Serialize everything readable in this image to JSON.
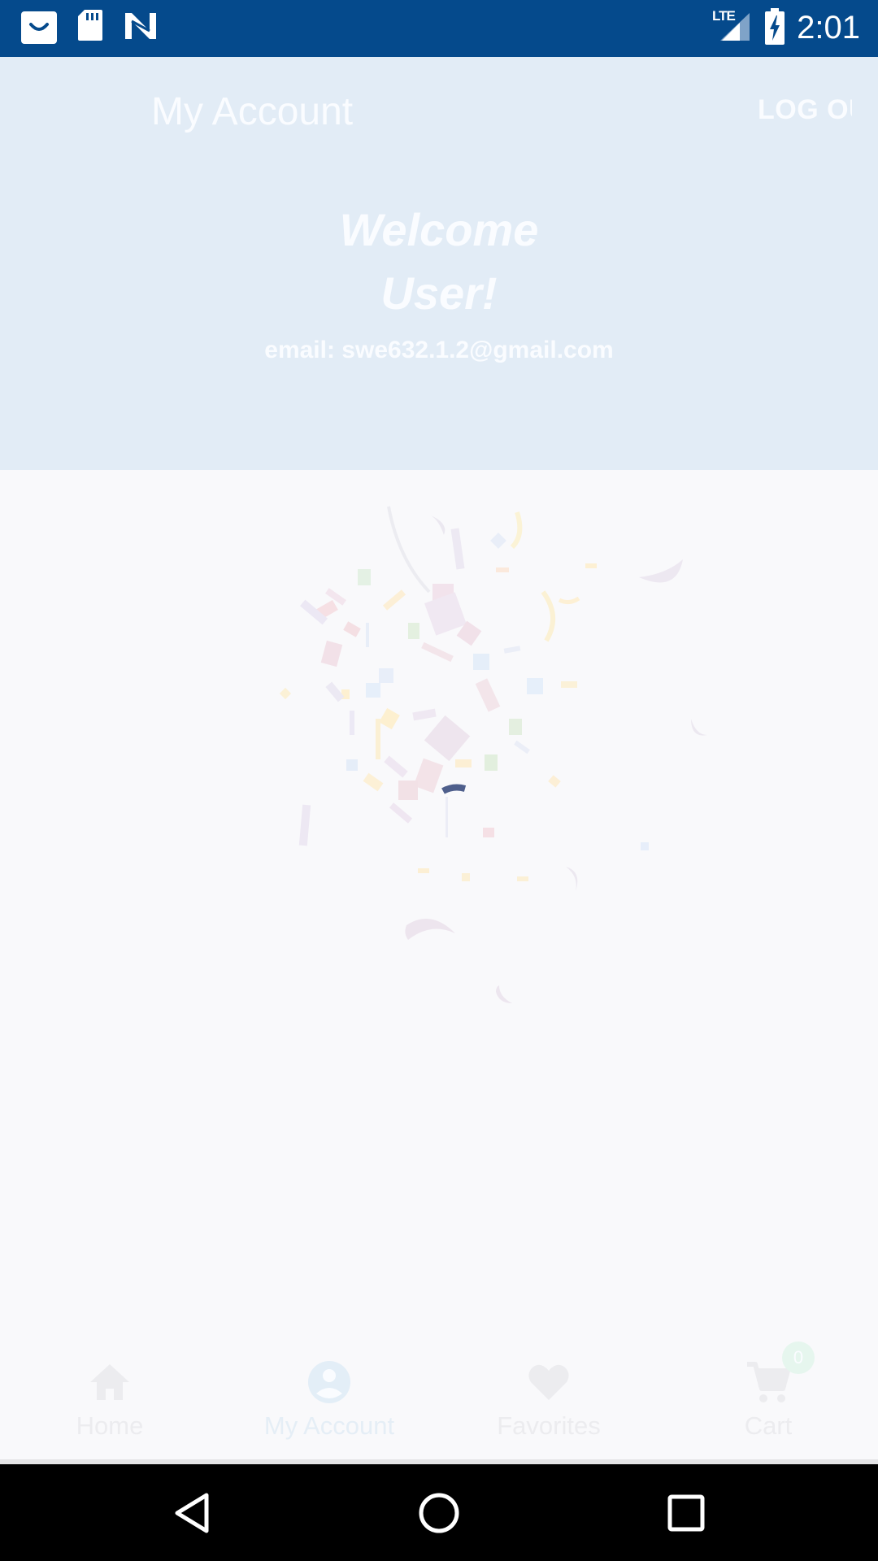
{
  "status_bar": {
    "time": "2:01",
    "network": "LTE",
    "icons": [
      "shopping-bag-icon",
      "sd-card-icon",
      "n-logo-icon",
      "signal-icon",
      "battery-charging-icon"
    ]
  },
  "header": {
    "title": "My Account",
    "logout_label": "LOG OUT",
    "welcome_line1": "Welcome",
    "welcome_line2": "User!",
    "email": "email: swe632.1.2@gmail.com",
    "background": "#e2ecf6"
  },
  "bottom_nav": {
    "items": [
      {
        "label": "Home",
        "icon": "home-icon"
      },
      {
        "label": "My Account",
        "icon": "account-circle-icon"
      },
      {
        "label": "Favorites",
        "icon": "heart-icon"
      },
      {
        "label": "Cart",
        "icon": "cart-icon"
      }
    ],
    "cart_count": "0"
  },
  "system_nav": {
    "buttons": [
      "back-icon",
      "home-circle-icon",
      "recents-icon"
    ]
  },
  "colors": {
    "status_bar": "#054a8c",
    "header_bg": "#e2ecf6",
    "page_bg": "#f9f9fb",
    "faded_text": "#fafcff",
    "nav_faded": "#ececef"
  }
}
